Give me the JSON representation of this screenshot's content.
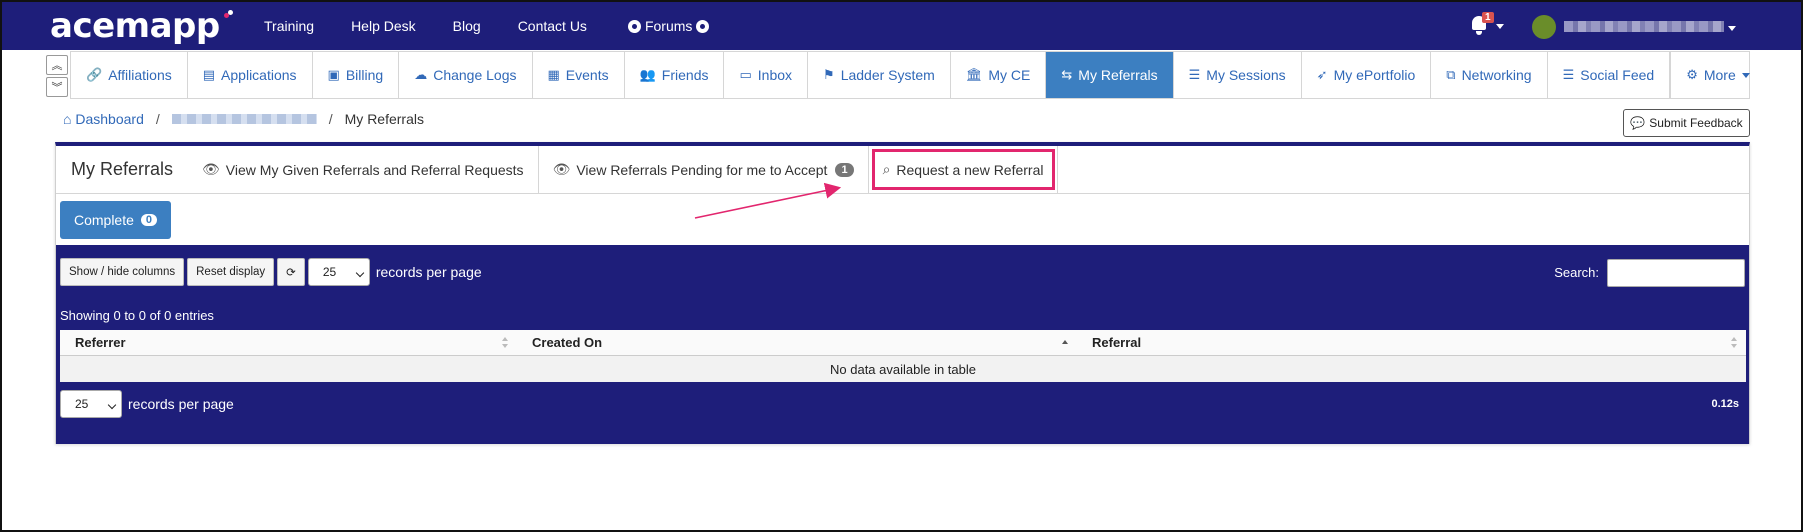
{
  "app": {
    "logo": "acemapp",
    "brand_color": "#1e1e7a",
    "accent": "#3c7fc1",
    "highlight": "#e2266e"
  },
  "topnav": {
    "items": [
      "Training",
      "Help Desk",
      "Blog",
      "Contact Us"
    ],
    "forums": "Forums",
    "notifications_count": "1"
  },
  "tabs": [
    {
      "label": "Affiliations",
      "icon": "link-icon"
    },
    {
      "label": "Applications",
      "icon": "id-card-icon"
    },
    {
      "label": "Billing",
      "icon": "money-icon"
    },
    {
      "label": "Change Logs",
      "icon": "cloud-icon"
    },
    {
      "label": "Events",
      "icon": "calendar-icon"
    },
    {
      "label": "Friends",
      "icon": "users-icon"
    },
    {
      "label": "Inbox",
      "icon": "inbox-icon"
    },
    {
      "label": "Ladder System",
      "icon": "ladder-icon"
    },
    {
      "label": "My CE",
      "icon": "institution-icon"
    },
    {
      "label": "My Referrals",
      "icon": "retweet-icon",
      "active": true
    },
    {
      "label": "My Sessions",
      "icon": "list-icon"
    },
    {
      "label": "My ePortfolio",
      "icon": "rocket-icon"
    },
    {
      "label": "Networking",
      "icon": "sitemap-icon"
    },
    {
      "label": "Social Feed",
      "icon": "list-icon"
    }
  ],
  "more_label": "More",
  "breadcrumb": {
    "home": "Dashboard",
    "current": "My Referrals"
  },
  "feedback_label": "Submit Feedback",
  "panel": {
    "title": "My Referrals",
    "tab_given": "View My Given Referrals and Referral Requests",
    "tab_pending": "View Referrals Pending for me to Accept",
    "pending_count": "1",
    "tab_request": "Request a new Referral",
    "complete_label": "Complete",
    "complete_count": "0"
  },
  "table": {
    "show_hide": "Show / hide columns",
    "reset": "Reset display",
    "per_page": "25",
    "records_per_page": "records per page",
    "search_label": "Search:",
    "info": "Showing 0 to 0 of 0 entries",
    "columns": [
      "Referrer",
      "Created On",
      "Referral"
    ],
    "empty": "No data available in table",
    "timing": "0.12s"
  }
}
